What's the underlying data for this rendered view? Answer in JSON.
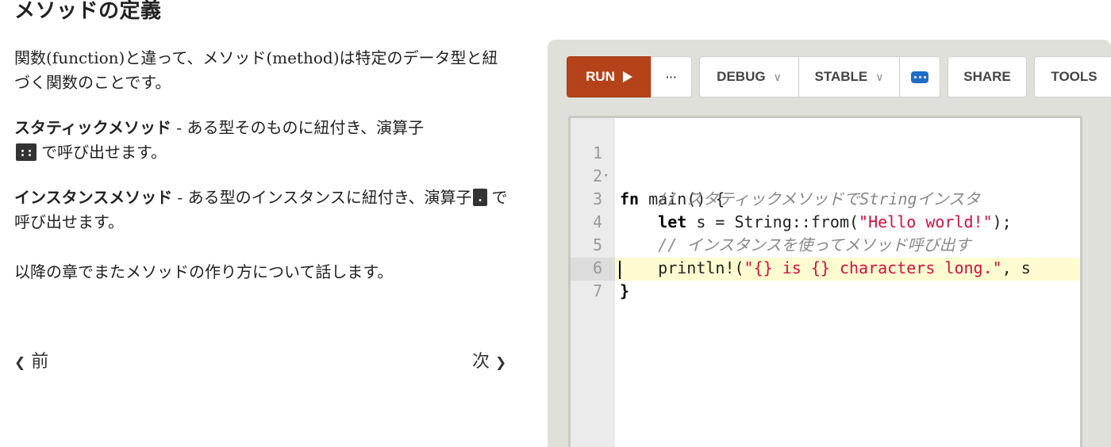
{
  "lesson": {
    "title": "メソッドの定義",
    "p1": "関数(function)と違って、メソッド(method)は特定のデータ型と紐づく関数のことです。",
    "static_term": "スタティックメソッド",
    "static_text": " - ある型そのものに紐付き、演算子",
    "static_op": "::",
    "static_tail": "で呼び出せます。",
    "instance_term": "インスタンスメソッド",
    "instance_text": " - ある型のインスタンスに紐付き、演算子",
    "instance_op": ".",
    "instance_tail": "で呼び出せます。",
    "p4": "以降の章でまたメソッドの作り方について話します。",
    "prev_label": "前",
    "next_label": "次",
    "prev_icon": "chevron-left-icon",
    "next_icon": "chevron-right-icon"
  },
  "playground": {
    "toolbar": {
      "run_label": "RUN",
      "more_label": "···",
      "debug_label": "DEBUG",
      "stable_label": "STABLE",
      "share_label": "SHARE",
      "tools_label": "TOOLS"
    },
    "colors": {
      "run_button": "#b54319",
      "config_icon": "#1f6dc7",
      "active_line": "#fefbd0",
      "string": "#d01040"
    },
    "code": {
      "line_numbers": [
        "1",
        "2",
        "3",
        "4",
        "5",
        "6",
        "7"
      ],
      "l1_kw": "fn",
      "l1_rest": " main() {",
      "l2_comment": "    // スタティックメソッドでStringインスタ",
      "l3_indent": "    ",
      "l3_kw": "let",
      "l3_mid": " s = String::from(",
      "l3_str": "\"Hello world!\"",
      "l3_end": ");",
      "l4_comment": "    // インスタンスを使ってメソッド呼び出す",
      "l5_pre": "    println!(",
      "l5_str": "\"{} is {} characters long.\"",
      "l5_end": ", s",
      "l6": "}",
      "l7": "",
      "active_line": 7
    }
  }
}
